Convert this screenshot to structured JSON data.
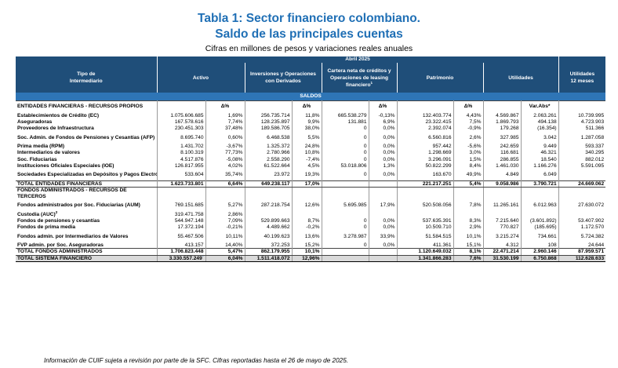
{
  "title": {
    "line1": "Tabla 1: Sector financiero colombiano.",
    "line2": "Saldo de las principales cuentas",
    "subtitle": "Cifras en millones de pesos y variaciones reales anuales"
  },
  "header": {
    "period": "Abril 2025",
    "tipo": "Tipo de\nIntermediario",
    "activo": "Activo",
    "inversiones": "Inversiones y Operaciones con Derivados",
    "cartera": "Cartera neta de créditos y Operaciones de leasing financiero",
    "cartera_sup": "1",
    "patrimonio": "Patrimonio",
    "utilidades": "Utilidades",
    "utilidades12": "Utilidades\n12 meses"
  },
  "saldos_label": "SALDOS",
  "entidades": {
    "title": "ENTIDADES FINANCIERAS - RECURSOS PROPIOS",
    "pct": "Δ%",
    "varabs": "Var.Abs*",
    "rows": [
      {
        "name": "Establecimientos de Crédito (EC)",
        "activo": "1.075.606.685",
        "activo_pct": "1,69%",
        "inv": "256.735.714",
        "inv_pct": "11,8%",
        "car": "665.538.279",
        "car_pct": "-0,13%",
        "pat": "132.403.774",
        "pat_pct": "4,43%",
        "util": "4.569.867",
        "var": "2.063.261",
        "u12": "10.739.995"
      },
      {
        "name": "Aseguradoras",
        "activo": "167.578.616",
        "activo_pct": "7,74%",
        "inv": "128.235.897",
        "inv_pct": "9,9%",
        "car": "131.881",
        "car_pct": "6,9%",
        "pat": "23.322.415",
        "pat_pct": "7,5%",
        "util": "1.869.793",
        "var": "494.138",
        "u12": "4.723.903"
      },
      {
        "name": "Proveedores de Infraestructura",
        "activo": "230.451.303",
        "activo_pct": "37,48%",
        "inv": "189.586.705",
        "inv_pct": "38,0%",
        "car": "0",
        "car_pct": "0,0%",
        "pat": "2.392.074",
        "pat_pct": "-0,9%",
        "util": "179.268",
        "var": "(16.354)",
        "u12": "511.366"
      },
      {
        "name": "Soc. Admin. de Fondos de Pensiones y Cesantías (AFP)",
        "two": true,
        "activo": "8.695.740",
        "activo_pct": "0,60%",
        "inv": "6.468.538",
        "inv_pct": "5,5%",
        "car": "0",
        "car_pct": "0,0%",
        "pat": "6.560.816",
        "pat_pct": "2,6%",
        "util": "327.985",
        "var": "3.042",
        "u12": "1.287.058"
      },
      {
        "name": "Prima media (RPM)",
        "activo": "1.431.702",
        "activo_pct": "-3,67%",
        "inv": "1.325.372",
        "inv_pct": "24,8%",
        "car": "0",
        "car_pct": "0,0%",
        "pat": "957.442",
        "pat_pct": "-5,6%",
        "util": "242.659",
        "var": "9.449",
        "u12": "593.337"
      },
      {
        "name": "Intermediarios de valores",
        "activo": "8.100.319",
        "activo_pct": "77,73%",
        "inv": "2.780.966",
        "inv_pct": "10,8%",
        "car": "0",
        "car_pct": "0,0%",
        "pat": "1.298.669",
        "pat_pct": "3,0%",
        "util": "116.681",
        "var": "46.321",
        "u12": "340.295"
      },
      {
        "name": "Soc. Fiduciarias",
        "activo": "4.517.876",
        "activo_pct": "-5,08%",
        "inv": "2.558.290",
        "inv_pct": "-7,4%",
        "car": "0",
        "car_pct": "0,0%",
        "pat": "3.296.091",
        "pat_pct": "1,5%",
        "util": "286.855",
        "var": "18.540",
        "u12": "882.012"
      },
      {
        "name": "Instituciones Oficiales Especiales (IOE)",
        "activo": "126.817.955",
        "activo_pct": "4,02%",
        "inv": "61.522.664",
        "inv_pct": "4,5%",
        "car": "53.018.806",
        "car_pct": "1,3%",
        "pat": "50.822.299",
        "pat_pct": "8,4%",
        "util": "1.461.030",
        "var": "1.166.276",
        "u12": "5.591.095"
      },
      {
        "name": "Sociedades Especializadas en Depósitos y Pagos Electrónicos - SEDPE",
        "two": true,
        "activo": "533.604",
        "activo_pct": "35,74%",
        "inv": "23.972",
        "inv_pct": "19,3%",
        "car": "0",
        "car_pct": "0,0%",
        "pat": "163.670",
        "pat_pct": "49,9%",
        "util": "4.849",
        "var": "6.049",
        "u12": ""
      }
    ],
    "total": {
      "name": "TOTAL ENTIDADES FINANCIERAS",
      "activo": "1.623.733.801",
      "activo_pct": "6,64%",
      "inv": "649.238.117",
      "inv_pct": "17,0%",
      "car": "",
      "car_pct": "",
      "pat": "221.217.251",
      "pat_pct": "5,4%",
      "util": "9.058.986",
      "var": "3.790.721",
      "u12": "24.669.062"
    }
  },
  "fondos": {
    "title": "FONDOS ADMINISTRADOS - RECURSOS DE TERCEROS",
    "rows": [
      {
        "name": "Fondos administrados por Soc. Fiduciarias (AUM)",
        "two": true,
        "activo": "769.151.685",
        "activo_pct": "5,27%",
        "inv": "287.218.754",
        "inv_pct": "12,6%",
        "car": "5.695.985",
        "car_pct": "17,9%",
        "pat": "520.508.056",
        "pat_pct": "7,8%",
        "util": "11.265.161",
        "var": "6.012.963",
        "u12": "27.630.072"
      },
      {
        "name": "Custodia (AUC)",
        "sup": "2",
        "activo": "319.471.758",
        "activo_pct": "2,86%",
        "inv": "",
        "inv_pct": "",
        "car": "",
        "car_pct": "",
        "pat": "",
        "pat_pct": "",
        "util": "",
        "var": "",
        "u12": ""
      },
      {
        "name": "Fondos de pensiones y cesantías",
        "activo": "544.947.148",
        "activo_pct": "7,09%",
        "inv": "529.899.663",
        "inv_pct": "8,7%",
        "car": "0",
        "car_pct": "0,0%",
        "pat": "537.635.391",
        "pat_pct": "8,3%",
        "util": "7.215.640",
        "var": "(3.601.892)",
        "u12": "53.407.902"
      },
      {
        "name": "Fondos de prima media",
        "activo": "17.372.194",
        "activo_pct": "-0,21%",
        "inv": "4.489.662",
        "inv_pct": "-0,2%",
        "car": "0",
        "car_pct": "0,0%",
        "pat": "10.509.710",
        "pat_pct": "2,9%",
        "util": "770.827",
        "var": "(185.695)",
        "u12": "1.172.570"
      },
      {
        "name": "Fondos admin. por Intermediarios de Valores",
        "two": true,
        "activo": "55.467.506",
        "activo_pct": "10,11%",
        "inv": "40.199.623",
        "inv_pct": "13,6%",
        "car": "3.278.987",
        "car_pct": "33,9%",
        "pat": "51.584.515",
        "pat_pct": "10,1%",
        "util": "3.215.274",
        "var": "734.661",
        "u12": "5.724.382"
      },
      {
        "name": "FVP admin. por Soc. Aseguradoras",
        "activo": "413.157",
        "activo_pct": "14,40%",
        "inv": "372.253",
        "inv_pct": "15,2%",
        "car": "0",
        "car_pct": "0,0%",
        "pat": "411.361",
        "pat_pct": "15,1%",
        "util": "4.312",
        "var": "108",
        "u12": "24.644"
      }
    ],
    "total": {
      "name": "TOTAL FONDOS ADMINISTRADOS",
      "activo": "1.706.823.448",
      "activo_pct": "5,47%",
      "inv": "862.179.955",
      "inv_pct": "10,1%",
      "car": "",
      "car_pct": "",
      "pat": "1.120.649.032",
      "pat_pct": "8,1%",
      "util": "22.471.214",
      "var": "2.960.146",
      "u12": "87.959.571"
    }
  },
  "grand": {
    "name": "TOTAL SISTEMA FINANCIERO",
    "activo": "3.330.557.249",
    "activo_sup": "*",
    "activo_pct": "6,04%",
    "inv": "1.511.418.072",
    "inv_pct": "12,96%",
    "car": "",
    "car_pct": "",
    "pat": "1.341.866.283",
    "pat_pct": "7,6%",
    "util": "31.530.199",
    "var": "6.750.868",
    "u12": "112.628.633"
  },
  "note": "Información de CUIF sujeta a revisión por parte de la SFC. Cifras reportadas hasta el 26 de mayo de 2025."
}
